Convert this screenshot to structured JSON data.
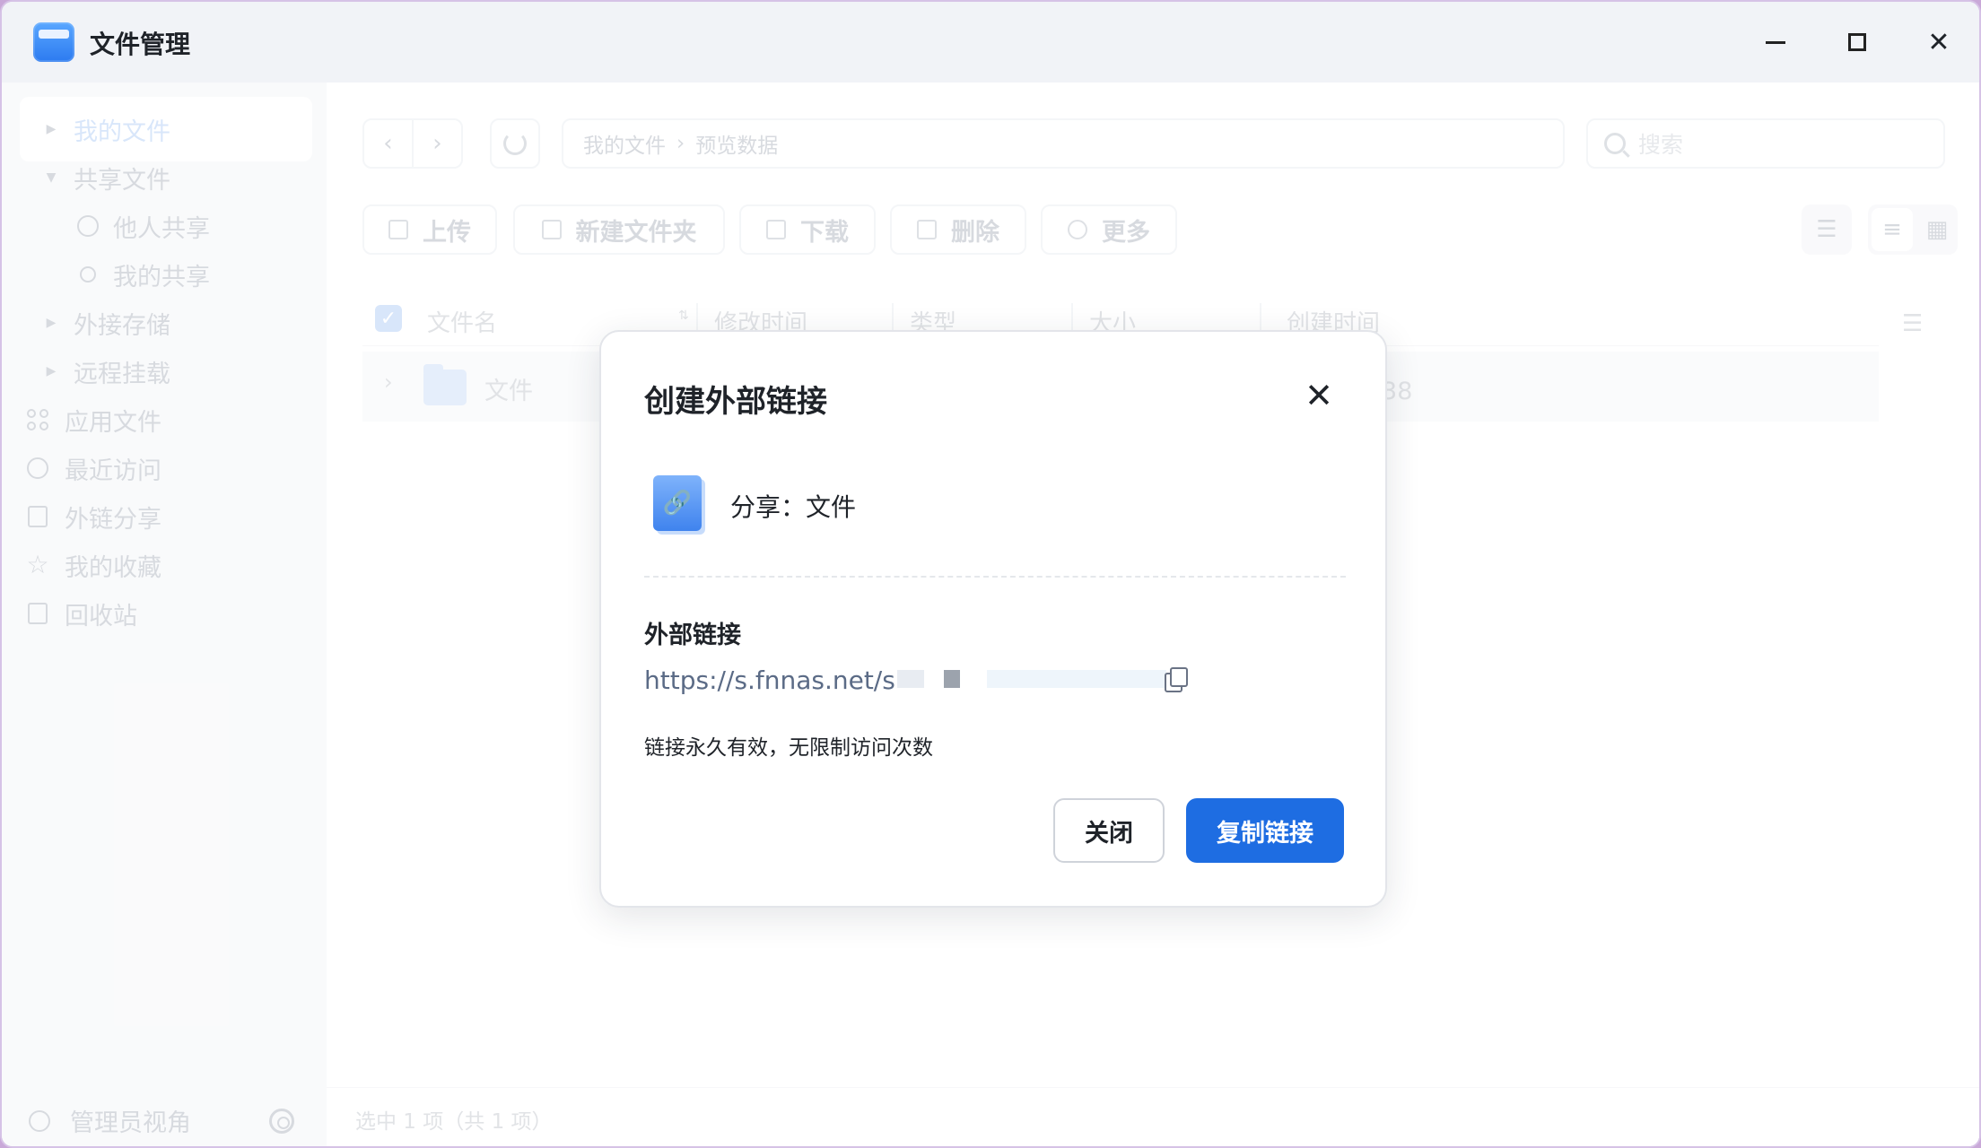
{
  "window": {
    "title": "文件管理",
    "controls": {
      "minimize": "minimize-icon",
      "maximize": "maximize-icon",
      "close": "close-icon"
    }
  },
  "sidebar": {
    "my_files": "我的文件",
    "shared_files": "共享文件",
    "shared_by_others": "他人共享",
    "my_shares": "我的共享",
    "external_storage": "外接存储",
    "remote_mount": "远程挂载",
    "app_files": "应用文件",
    "recent": "最近访问",
    "link_shares": "外链分享",
    "favorites": "我的收藏",
    "trash": "回收站",
    "footer_label": "管理员视角"
  },
  "breadcrumb": {
    "root": "我的文件",
    "separator": "›",
    "current": "预览数据"
  },
  "search": {
    "placeholder": "搜索"
  },
  "toolbar": {
    "upload": "上传",
    "new_folder": "新建文件夹",
    "download": "下载",
    "delete": "删除",
    "more": "更多"
  },
  "table": {
    "columns": [
      "文件名",
      "修改时间",
      "类型",
      "大小",
      "创建时间"
    ],
    "rows": [
      {
        "name": "文件",
        "modified": "",
        "type": "",
        "size": "-",
        "created": "今天 15:38"
      }
    ]
  },
  "status": {
    "selection": "选中 1 项（共 1 项）"
  },
  "dialog": {
    "title": "创建外部链接",
    "share_label": "分享：文件",
    "section_title": "外部链接",
    "link": "https://s.fnnas.net/s",
    "validity": "链接永久有效，无限制访问次数",
    "close_button": "关闭",
    "copy_button": "复制链接"
  },
  "colors": {
    "primary": "#1e6de2",
    "sidebar_bg": "#f5f6f8",
    "titlebar_bg": "#f1f3f7"
  }
}
